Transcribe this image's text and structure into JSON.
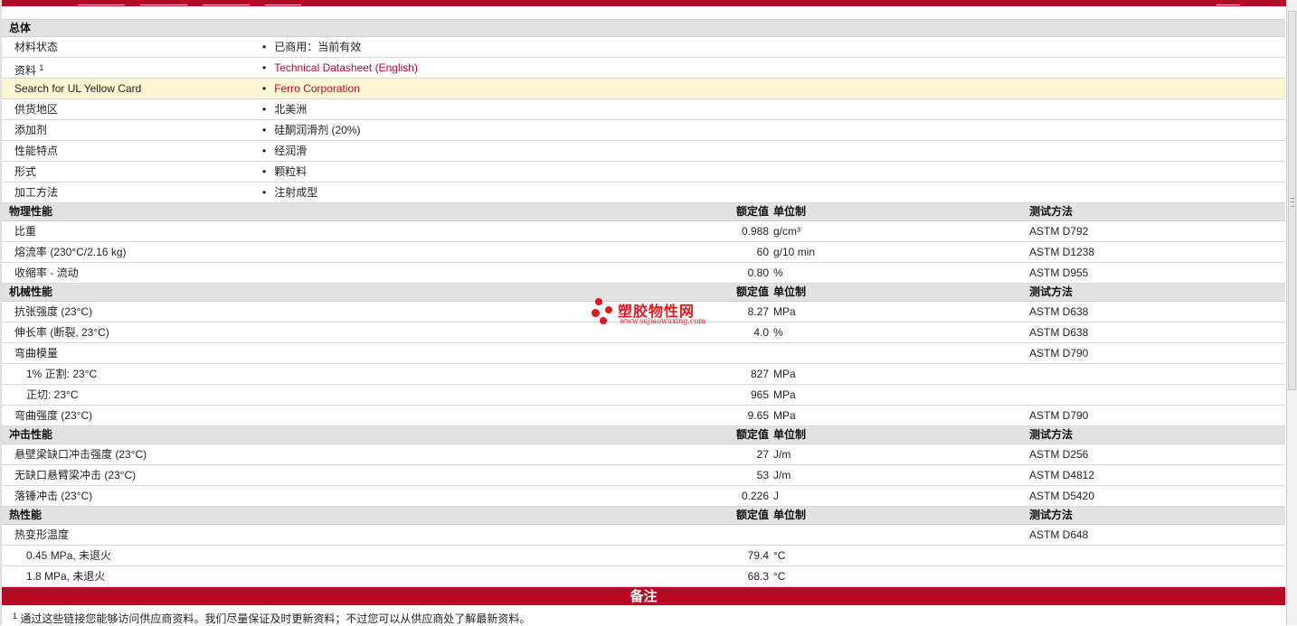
{
  "sections": {
    "general": {
      "title": "总体",
      "rows": [
        {
          "name": "材料状态",
          "value": "已商用：当前有效"
        },
        {
          "name": "资料",
          "sup": "1",
          "value": "Technical Datasheet (English)"
        },
        {
          "name": "Search for UL Yellow Card",
          "value": "Ferro Corporation"
        },
        {
          "name": "供货地区",
          "value": "北美洲"
        },
        {
          "name": "添加剂",
          "value": "硅酮润滑剂 (20%)"
        },
        {
          "name": "性能特点",
          "value": "经润滑"
        },
        {
          "name": "形式",
          "value": "颗粒料"
        },
        {
          "name": "加工方法",
          "value": "注射成型"
        }
      ]
    },
    "headers": {
      "value": "额定值",
      "unit": "单位制",
      "test": "测试方法"
    },
    "physical": {
      "title": "物理性能",
      "rows": [
        {
          "name": "比重",
          "value": "0.988",
          "unit": "g/cm³",
          "test": "ASTM D792"
        },
        {
          "name": "熔流率 (230°C/2.16 kg)",
          "value": "60",
          "unit": "g/10 min",
          "test": "ASTM D1238"
        },
        {
          "name": "收缩率 - 流动",
          "value": "0.80",
          "unit": "%",
          "test": "ASTM D955"
        }
      ]
    },
    "mechanical": {
      "title": "机械性能",
      "rows": [
        {
          "name": "抗张强度 (23°C)",
          "value": "8.27",
          "unit": "MPa",
          "test": "ASTM D638"
        },
        {
          "name": "伸长率 (断裂, 23°C)",
          "value": "4.0",
          "unit": "%",
          "test": "ASTM D638"
        },
        {
          "name": "弯曲模量",
          "value": "",
          "unit": "",
          "test": "ASTM D790"
        },
        {
          "name": "1% 正割: 23°C",
          "value": "827",
          "unit": "MPa",
          "test": ""
        },
        {
          "name": "正切: 23°C",
          "value": "965",
          "unit": "MPa",
          "test": ""
        },
        {
          "name": "弯曲强度 (23°C)",
          "value": "9.65",
          "unit": "MPa",
          "test": "ASTM D790"
        }
      ]
    },
    "impact": {
      "title": "冲击性能",
      "rows": [
        {
          "name": "悬壁梁缺口冲击强度 (23°C)",
          "value": "27",
          "unit": "J/m",
          "test": "ASTM D256"
        },
        {
          "name": "无缺口悬臂梁冲击 (23°C)",
          "value": "53",
          "unit": "J/m",
          "test": "ASTM D4812"
        },
        {
          "name": "落锤冲击 (23°C)",
          "value": "0.226",
          "unit": "J",
          "test": "ASTM D5420"
        }
      ]
    },
    "thermal": {
      "title": "热性能",
      "rows": [
        {
          "name": "热变形温度",
          "value": "",
          "unit": "",
          "test": "ASTM D648"
        },
        {
          "name": "0.45 MPa, 未退火",
          "value": "79.4",
          "unit": "°C",
          "test": ""
        },
        {
          "name": "1.8 MPa, 未退火",
          "value": "68.3",
          "unit": "°C",
          "test": ""
        }
      ]
    }
  },
  "notes": {
    "title": "备注",
    "footnote_mark": "1",
    "footnote_text": "通过这些链接您能够访问供应商资料。我们尽量保证及时更新资料；不过您可以从供应商处了解最新资料。"
  },
  "watermark": {
    "brand": "塑胶物性网",
    "url": "www.sujiaowuxing.com",
    "color": "#e3141f"
  },
  "colors": {
    "accent": "#b40a24",
    "link": "#a5122a",
    "highlight": "#fbf6d2",
    "section_bg": "#e2e2e2"
  }
}
